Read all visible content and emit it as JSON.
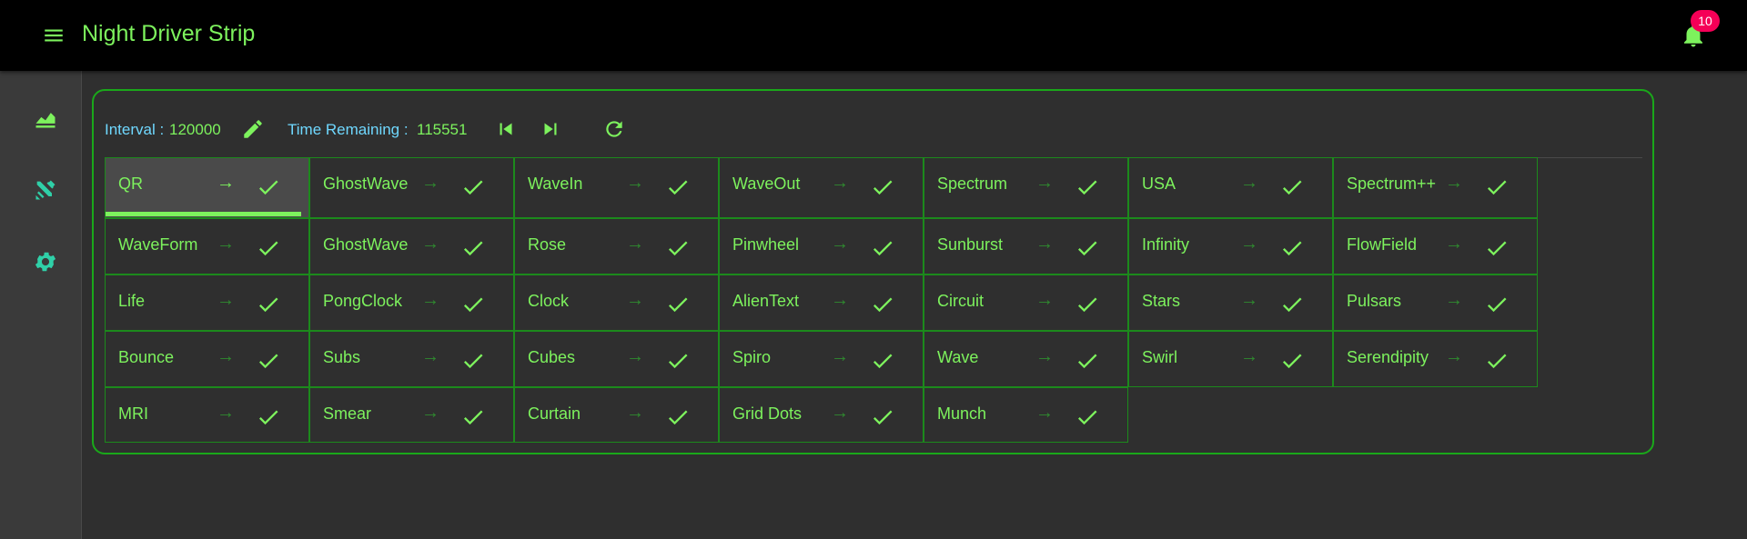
{
  "app": {
    "title": "Night Driver Strip",
    "notification_count": "10"
  },
  "toolbar": {
    "interval_label": "Interval :",
    "interval_value": "120000",
    "time_remaining_label": "Time Remaining :",
    "time_remaining_value": "115551"
  },
  "colors": {
    "accent": "#7df25d",
    "label": "#6fd8ff",
    "border": "#1aa81a",
    "badge": "#f50057"
  },
  "effects": [
    {
      "name": "QR",
      "active": true
    },
    {
      "name": "GhostWave"
    },
    {
      "name": "WaveIn"
    },
    {
      "name": "WaveOut"
    },
    {
      "name": "Spectrum"
    },
    {
      "name": "USA"
    },
    {
      "name": "Spectrum++"
    },
    {
      "name": "WaveForm"
    },
    {
      "name": "GhostWave"
    },
    {
      "name": "Rose"
    },
    {
      "name": "Pinwheel"
    },
    {
      "name": "Sunburst"
    },
    {
      "name": "Infinity"
    },
    {
      "name": "FlowField"
    },
    {
      "name": "Life"
    },
    {
      "name": "PongClock"
    },
    {
      "name": "Clock"
    },
    {
      "name": "AlienText"
    },
    {
      "name": "Circuit"
    },
    {
      "name": "Stars"
    },
    {
      "name": "Pulsars"
    },
    {
      "name": "Bounce"
    },
    {
      "name": "Subs"
    },
    {
      "name": "Cubes"
    },
    {
      "name": "Spiro"
    },
    {
      "name": "Wave"
    },
    {
      "name": "Swirl"
    },
    {
      "name": "Serendipity"
    },
    {
      "name": "MRI"
    },
    {
      "name": "Smear"
    },
    {
      "name": "Curtain"
    },
    {
      "name": "Grid Dots"
    },
    {
      "name": "Munch"
    }
  ],
  "icons": {
    "menu": "menu-icon",
    "notifications": "bell-icon",
    "nav": [
      "chart-icon",
      "tools-icon",
      "gear-icon"
    ],
    "toolbar": [
      "edit-icon",
      "skip-previous-icon",
      "skip-next-icon",
      "refresh-icon"
    ],
    "cell": [
      "arrow-right-icon",
      "check-icon"
    ]
  }
}
